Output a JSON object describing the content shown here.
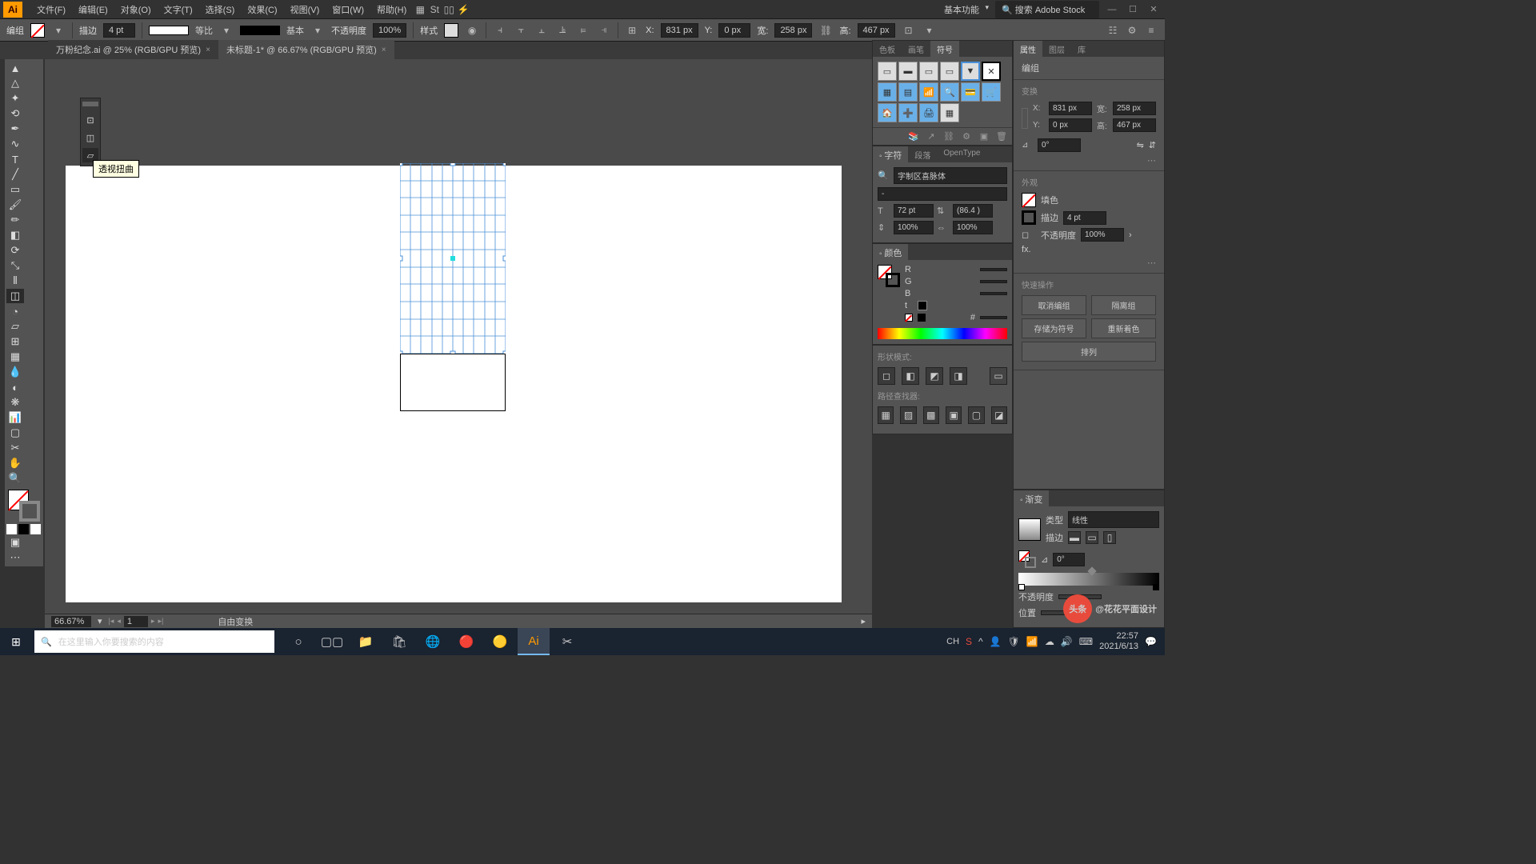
{
  "menubar": {
    "items": [
      "文件(F)",
      "编辑(E)",
      "对象(O)",
      "文字(T)",
      "选择(S)",
      "效果(C)",
      "视图(V)",
      "窗口(W)",
      "帮助(H)"
    ],
    "workspace": "基本功能",
    "search_placeholder": "搜索 Adobe Stock"
  },
  "controlbar": {
    "mode": "编组",
    "stroke_label": "描边",
    "stroke_weight": "4 pt",
    "stroke_profile": "等比",
    "stroke_brush": "基本",
    "opacity_label": "不透明度",
    "opacity": "100%",
    "style_label": "样式",
    "x_label": "X:",
    "x": "831 px",
    "y_label": "Y:",
    "y": "0 px",
    "w_label": "宽:",
    "w": "258 px",
    "h_label": "高:",
    "h": "467 px"
  },
  "tabs": [
    {
      "label": "万粉纪念.ai @ 25% (RGB/GPU 预览)",
      "active": false
    },
    {
      "label": "未标题-1* @ 66.67% (RGB/GPU 预览)",
      "active": true
    }
  ],
  "tooltip": "透视扭曲",
  "statusbar": {
    "zoom": "66.67%",
    "page": "1",
    "mode": "自由变换"
  },
  "panels": {
    "symbols": {
      "tabs": [
        "色板",
        "画笔",
        "符号"
      ],
      "active": 2
    },
    "char": {
      "tabs": [
        "字符",
        "段落",
        "OpenType"
      ],
      "active": 0,
      "font": "字制区喜脉体",
      "size": "72 pt",
      "leading": "(86.4 )",
      "tracking": "100%",
      "kerning": "100%"
    },
    "color": {
      "title": "颜色",
      "r": "R",
      "g": "G",
      "b": "B",
      "hex": "#"
    },
    "shapemode": {
      "title": "形状模式:",
      "path_title": "路径查找器:"
    },
    "gradient": {
      "title": "渐变",
      "type_label": "类型",
      "type": "线性",
      "stroke_label": "描边",
      "angle": "0°",
      "opacity_label": "不透明度",
      "pos_label": "位置"
    },
    "properties": {
      "tabs": [
        "属性",
        "图层",
        "库"
      ],
      "obj": "编组",
      "transform_title": "变换",
      "x": "831 px",
      "y": "0 px",
      "w": "258 px",
      "h": "467 px",
      "angle": "0°",
      "appearance_title": "外观",
      "fill_label": "填色",
      "stroke_label": "描边",
      "stroke_w": "4 pt",
      "opacity_label": "不透明度",
      "opacity": "100%",
      "fx": "fx.",
      "quick_title": "快速操作",
      "btns": [
        "取消编组",
        "隔离组",
        "存储为符号",
        "重新着色",
        "排列"
      ]
    }
  },
  "taskbar": {
    "search_placeholder": "在这里输入你要搜索的内容",
    "ime": "CH",
    "time": "22:57",
    "date": "2021/6/13"
  },
  "watermark": "@花花平面设计",
  "watermark_brand": "头条"
}
